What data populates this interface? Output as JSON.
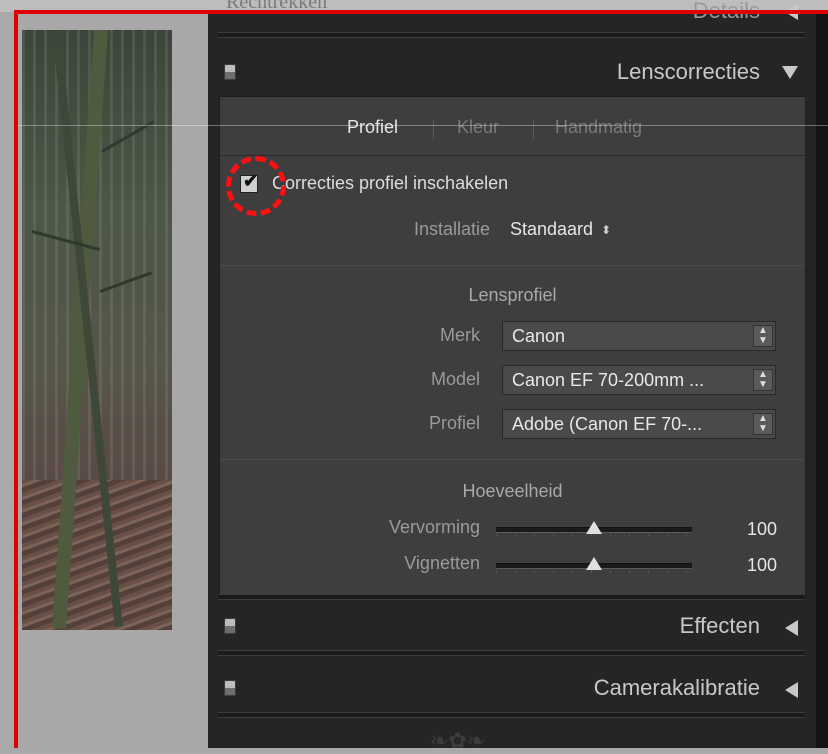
{
  "top_strip": {
    "text": "Rechtrekken"
  },
  "details": {
    "title": "Details"
  },
  "lens": {
    "title": "Lenscorrecties",
    "tabs": [
      "Profiel",
      "Kleur",
      "Handmatig"
    ],
    "enable_label": "Correcties profiel inschakelen",
    "installatie_label": "Installatie",
    "installatie_value": "Standaard",
    "lensprofiel_title": "Lensprofiel",
    "fields": [
      {
        "label": "Merk",
        "value": "Canon"
      },
      {
        "label": "Model",
        "value": "Canon EF 70-200mm ..."
      },
      {
        "label": "Profiel",
        "value": "Adobe (Canon EF 70-..."
      }
    ],
    "hoeveelheid_title": "Hoeveelheid",
    "sliders": [
      {
        "label": "Vervorming",
        "value": "100",
        "position": 0.5
      },
      {
        "label": "Vignetten",
        "value": "100",
        "position": 0.5
      }
    ]
  },
  "effecten": {
    "title": "Effecten"
  },
  "camerakalibratie": {
    "title": "Camerakalibratie"
  },
  "icons": {
    "collapse": "triangle-down",
    "expand": "triangle-left",
    "checkbox": "checkmark",
    "stepper": "up-down-arrows"
  },
  "colors": {
    "highlight": "#ff1010",
    "panel": "#252525",
    "body": "#3e3e3e"
  }
}
